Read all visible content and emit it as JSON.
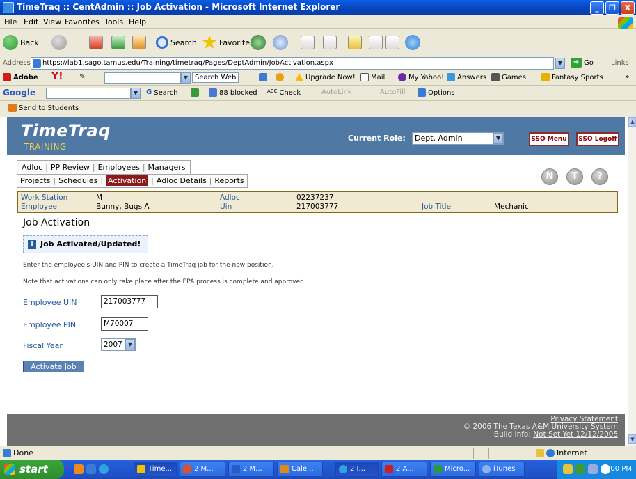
{
  "window": {
    "title": "TimeTraq :: CentAdmin :: Job Activation - Microsoft Internet Explorer",
    "minimize": "_",
    "restore": "❐",
    "close": "X"
  },
  "menu": [
    "File",
    "Edit",
    "View",
    "Favorites",
    "Tools",
    "Help"
  ],
  "toolbar": {
    "back": "Back",
    "search": "Search",
    "favorites": "Favorites"
  },
  "address": {
    "label": "Address",
    "url": "https://lab1.sago.tamus.edu/Training/timetraq/Pages/DeptAdmin/JobActivation.aspx",
    "go": "Go",
    "links": "Links"
  },
  "yahoo_bar": {
    "adobe": "Adobe",
    "yahoo": "Y!",
    "search_web": "Search Web",
    "upgrade": "Upgrade Now!",
    "mail": "Mail",
    "my_yahoo": "My Yahoo!",
    "answers": "Answers",
    "games": "Games",
    "fantasy": "Fantasy Sports",
    "more": "»"
  },
  "google_bar": {
    "google": "Google",
    "search": "Search",
    "blocked": "88 blocked",
    "check": "Check",
    "autolink": "AutoLink",
    "autofill": "AutoFill",
    "options": "Options"
  },
  "links_bar": {
    "send_to_students": "Send to Students"
  },
  "app": {
    "logo": "TimeTraq",
    "subtitle": "TRAINING",
    "current_role_label": "Current Role:",
    "current_role": "Dept. Admin",
    "sso_menu": "SSO Menu",
    "sso_logoff": "SSO Logoff"
  },
  "nav": {
    "row1": [
      "Adloc",
      "PP Review",
      "Employees",
      "Managers"
    ],
    "row2": [
      "Projects",
      "Schedules",
      "Activation",
      "Adloc Details",
      "Reports"
    ],
    "help_icons": [
      "N",
      "T",
      "?"
    ]
  },
  "info": {
    "work_station_label": "Work Station",
    "work_station": "M",
    "adloc_label": "Adloc",
    "adloc": "02237237",
    "employee_label": "Employee",
    "employee": "Bunny, Bugs A",
    "uin_label": "Uin",
    "uin": "217003777",
    "job_title_label": "Job Title",
    "job_title": "Mechanic"
  },
  "page": {
    "title": "Job Activation",
    "notice": "Job Activated/Updated!",
    "notice_icon": "i",
    "instruction1": "Enter the employee's UIN and PIN to create a TimeTraq job for the new position.",
    "instruction2": "Note that activations can only take place after the EPA process is complete and approved.",
    "uin_label": "Employee UIN",
    "uin_value": "217003777",
    "pin_label": "Employee PIN",
    "pin_value": "M70007",
    "fy_label": "Fiscal Year",
    "fy_value": "2007",
    "activate_button": "Activate Job"
  },
  "footer": {
    "privacy": "Privacy Statement",
    "copyright": "© 2006",
    "org": "The Texas A&M University System",
    "build_label": "Build Info:",
    "build": "Not Set Yet 12/12/2005"
  },
  "status": {
    "done": "Done",
    "zone": "Internet"
  },
  "taskbar": {
    "start": "start",
    "tasks": [
      "Time...",
      "2 M...",
      "2 M...",
      "Cale...",
      "2 I...",
      "2 A...",
      "Micro...",
      "iTunes"
    ],
    "clock": "3:00 PM"
  },
  "colors": {
    "header_blue": "#4f78a4",
    "active_tab": "#8b1a1a",
    "info_bg": "#f1ead2",
    "footer_gray": "#6f6f6f",
    "training_yellow": "#f1d64a"
  }
}
